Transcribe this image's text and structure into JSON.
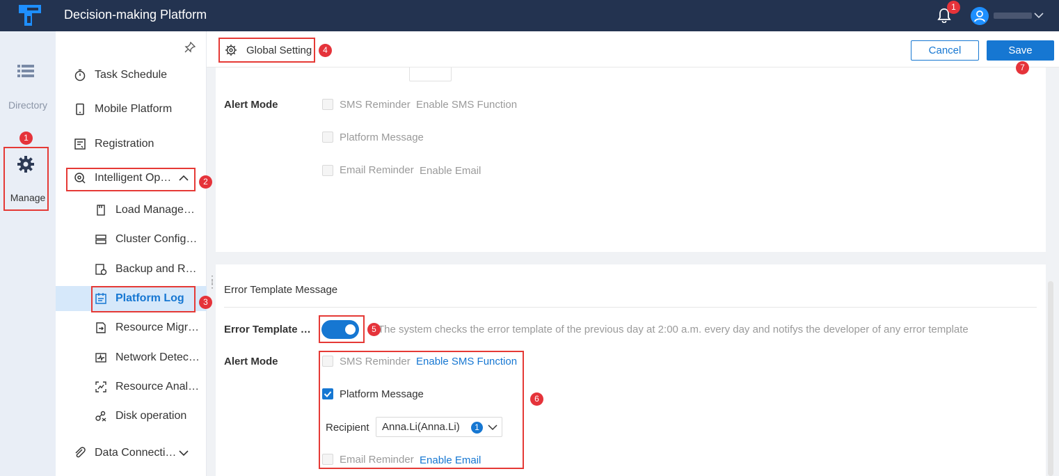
{
  "app": {
    "title": "Decision-making Platform"
  },
  "header": {
    "notification_count": "1"
  },
  "rail": {
    "directory_label": "Directory",
    "manage_label": "Manage"
  },
  "nav": {
    "items": [
      {
        "label": "Task Schedule",
        "icon": "stopwatch-icon"
      },
      {
        "label": "Mobile Platform",
        "icon": "mobile-icon"
      },
      {
        "label": "Registration",
        "icon": "registration-icon"
      },
      {
        "label": "Intelligent Operation and Maintenance",
        "icon": "intelligent-om-icon",
        "expanded": true
      },
      {
        "label": "Load Management",
        "icon": "load-icon"
      },
      {
        "label": "Cluster Configuration",
        "icon": "cluster-icon"
      },
      {
        "label": "Backup and Restore",
        "icon": "backup-icon"
      },
      {
        "label": "Platform Log",
        "icon": "platform-log-icon",
        "active": true
      },
      {
        "label": "Resource Migration",
        "icon": "resource-migration-icon"
      },
      {
        "label": "Network Detection",
        "icon": "network-icon"
      },
      {
        "label": "Resource Analysis",
        "icon": "resource-analysis-icon"
      },
      {
        "label": "Disk operation",
        "icon": "disk-icon"
      },
      {
        "label": "Data Connection",
        "icon": "data-connection-icon"
      }
    ]
  },
  "page": {
    "title": "Global Setting",
    "cancel_label": "Cancel",
    "save_label": "Save"
  },
  "upper_section": {
    "alert_mode_label": "Alert Mode",
    "sms_label": "SMS Reminder",
    "sms_link": "Enable SMS Function",
    "platform_label": "Platform Message",
    "email_label": "Email Reminder",
    "email_link": "Enable Email"
  },
  "error_section": {
    "title": "Error Template Message",
    "toggle_label": "Error Template Message",
    "toggle_on": true,
    "description": "The system checks the error template of the previous day at 2:00 a.m. every day and notifys the developer of any error template",
    "alert_mode_label": "Alert Mode",
    "sms_label": "SMS Reminder",
    "sms_link": "Enable SMS Function",
    "platform_label": "Platform Message",
    "platform_checked": true,
    "recipient_label": "Recipient",
    "recipient_value": "Anna.Li(Anna.Li)",
    "recipient_count": "1",
    "email_label": "Email Reminder",
    "email_link": "Enable Email"
  },
  "annotations": [
    "1",
    "1",
    "2",
    "3",
    "4",
    "5",
    "6",
    "7"
  ],
  "colors": {
    "header_bg": "#233350",
    "accent": "#1677d2",
    "annotation_red": "#e53935"
  }
}
